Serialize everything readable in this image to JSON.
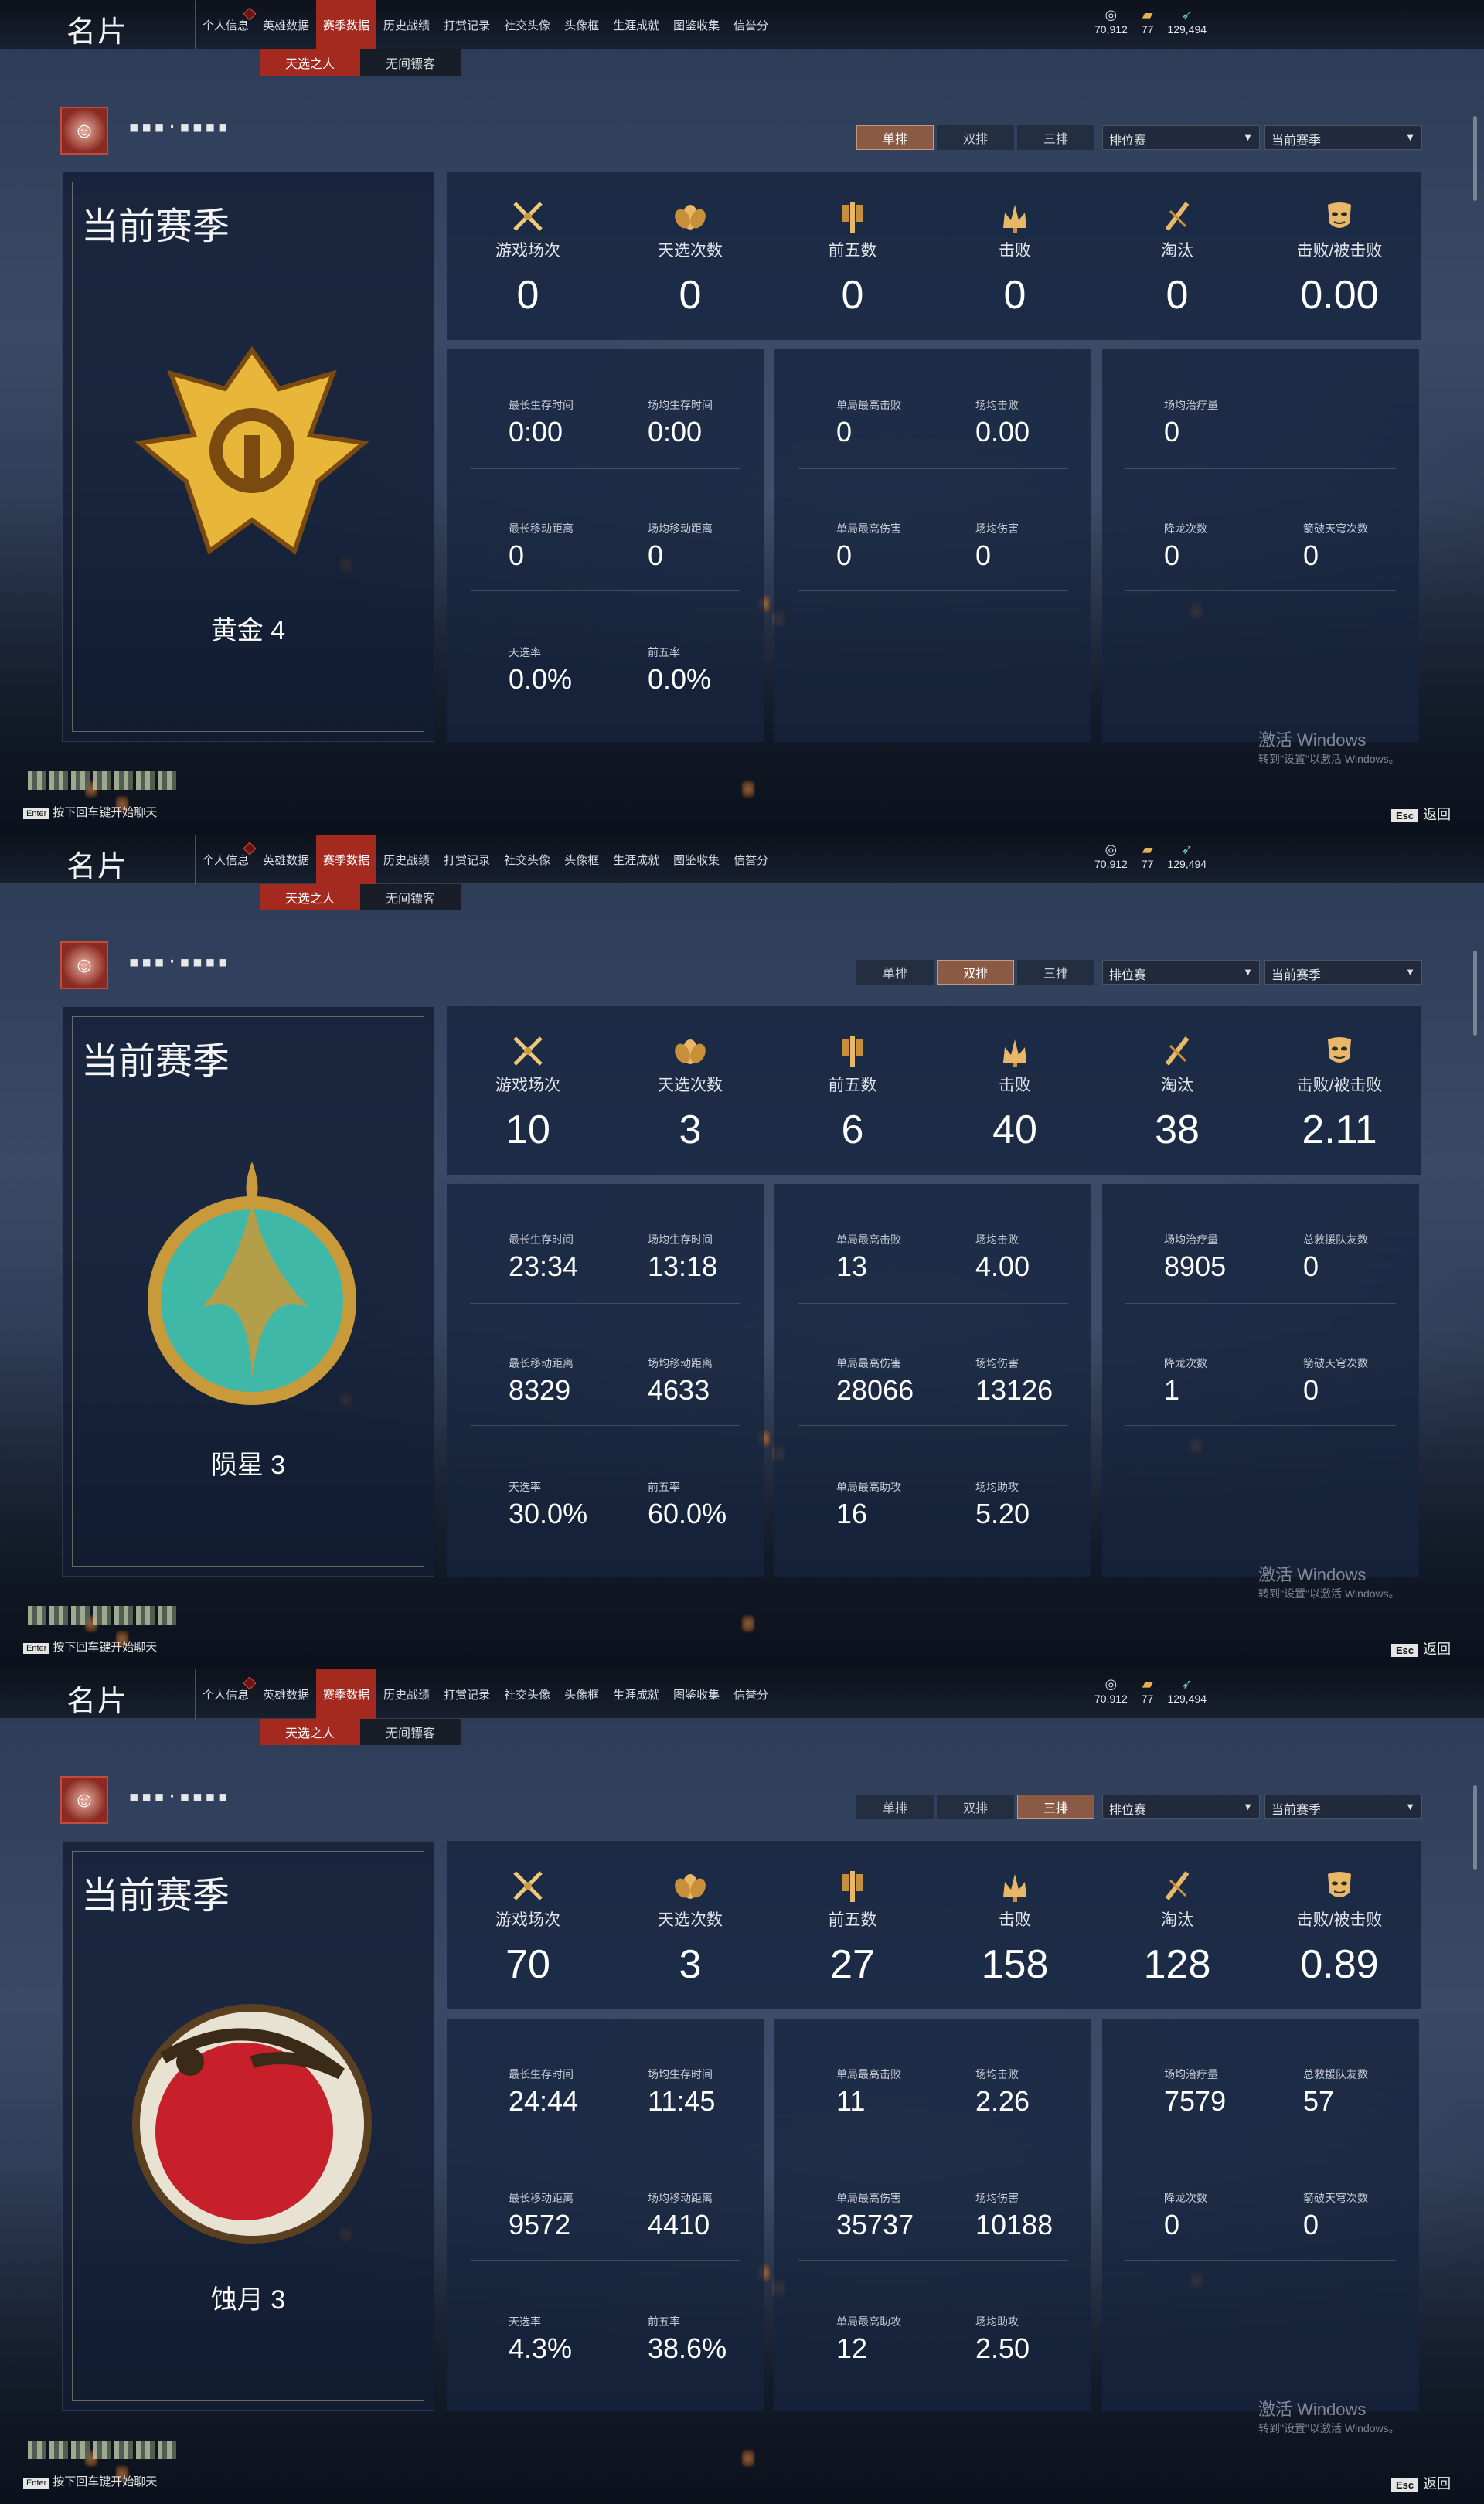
{
  "header": {
    "title": "名片",
    "nav": [
      {
        "label": "个人信息",
        "dot": true
      },
      {
        "label": "英雄数据"
      },
      {
        "label": "赛季数据",
        "active": true
      },
      {
        "label": "历史战绩"
      },
      {
        "label": "打赏记录"
      },
      {
        "label": "社交头像"
      },
      {
        "label": "头像框"
      },
      {
        "label": "生涯成就"
      },
      {
        "label": "图鉴收集"
      },
      {
        "label": "信誉分"
      }
    ],
    "currencies": [
      {
        "icon": "coin-icon",
        "value": "70,912"
      },
      {
        "icon": "ticket-icon",
        "value": "77"
      },
      {
        "icon": "feather-icon",
        "value": "129,494"
      }
    ],
    "subtabs": [
      "天选之人",
      "无间镖客"
    ]
  },
  "profile": {
    "username": "▪▪▪·▪▪▪▪"
  },
  "mode_tabs": [
    "单排",
    "双排",
    "三排"
  ],
  "dropdowns": {
    "match_type": "排位赛",
    "season": "当前赛季"
  },
  "season_title": "当前赛季",
  "stat_labels": [
    "游戏场次",
    "天选次数",
    "前五数",
    "击败",
    "淘汰",
    "击败/被击败"
  ],
  "stat_icons": [
    "swords-icon",
    "lotus-icon",
    "flag-icon",
    "crown-icon",
    "slash-icon",
    "mask-icon"
  ],
  "detail_labels": {
    "survival": [
      "最长生存时间",
      "场均生存时间",
      "最长移动距离",
      "场均移动距离",
      "天选率",
      "前五率"
    ],
    "combat": [
      "单局最高击败",
      "场均击败",
      "单局最高伤害",
      "场均伤害",
      "单局最高助攻",
      "场均助攻"
    ],
    "support": [
      "场均治疗量",
      "总救援队友数",
      "降龙次数",
      "箭破天穹次数"
    ]
  },
  "footer": {
    "chat_hint": "按下回车键开始聊天",
    "enter_key": "Enter",
    "esc_key": "Esc",
    "back_label": "返回",
    "watermark_1": "激活 Windows",
    "watermark_2": "转到\"设置\"以激活 Windows。"
  },
  "panels": [
    {
      "mode": 0,
      "rank": {
        "name": "黄金 4",
        "emblem": "gold-emblem-icon"
      },
      "stats": [
        "0",
        "0",
        "0",
        "0",
        "0",
        "0.00"
      ],
      "survival": [
        "0:00",
        "0:00",
        "0",
        "0",
        "0.0%",
        "0.0%"
      ],
      "combat": [
        "0",
        "0.00",
        "0",
        "0",
        null,
        null
      ],
      "support": [
        "0",
        null,
        "0",
        "0"
      ],
      "colors": {
        "emblem_primary": "#e8b73a",
        "emblem_secondary": "#7a4a10"
      }
    },
    {
      "mode": 1,
      "rank": {
        "name": "陨星 3",
        "emblem": "meteor-emblem-icon"
      },
      "stats": [
        "10",
        "3",
        "6",
        "40",
        "38",
        "2.11"
      ],
      "survival": [
        "23:34",
        "13:18",
        "8329",
        "4633",
        "30.0%",
        "60.0%"
      ],
      "combat": [
        "13",
        "4.00",
        "28066",
        "13126",
        "16",
        "5.20"
      ],
      "support": [
        "8905",
        "0",
        "1",
        "0"
      ],
      "colors": {
        "emblem_primary": "#3fb8a8",
        "emblem_secondary": "#c89a3a"
      }
    },
    {
      "mode": 2,
      "rank": {
        "name": "蚀月 3",
        "emblem": "eclipse-emblem-icon"
      },
      "stats": [
        "70",
        "3",
        "27",
        "158",
        "128",
        "0.89"
      ],
      "survival": [
        "24:44",
        "11:45",
        "9572",
        "4410",
        "4.3%",
        "38.6%"
      ],
      "combat": [
        "11",
        "2.26",
        "35737",
        "10188",
        "12",
        "2.50"
      ],
      "support": [
        "7579",
        "57",
        "0",
        "0"
      ],
      "colors": {
        "emblem_primary": "#c8202a",
        "emblem_secondary": "#e8e2d2"
      }
    }
  ]
}
